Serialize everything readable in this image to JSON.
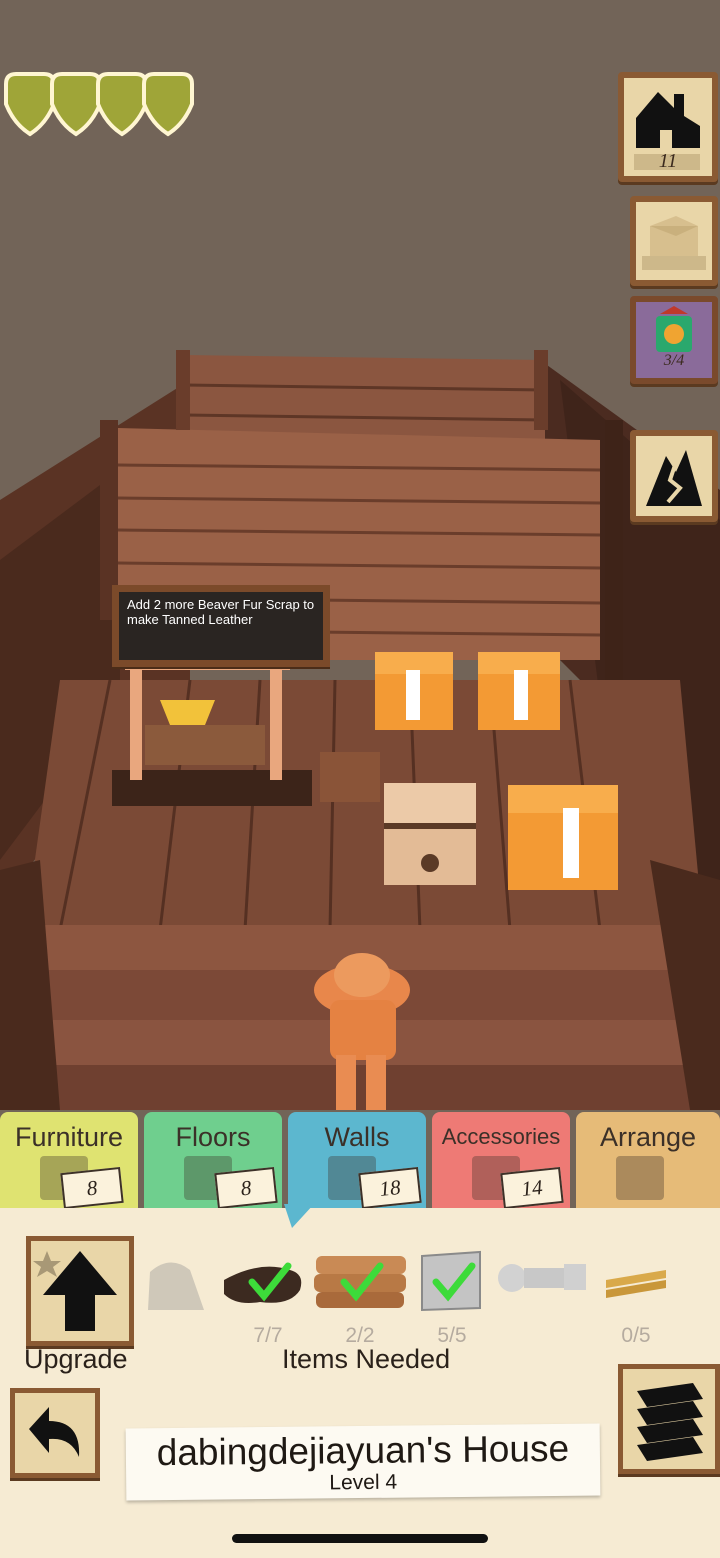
{
  "hud": {
    "hearts": 4,
    "heart_color": "#9fa538",
    "buttons": [
      {
        "name": "house-icon",
        "count": "11"
      },
      {
        "name": "box-icon",
        "count": ""
      },
      {
        "name": "totem-icon",
        "count": "3/4"
      },
      {
        "name": "map-icon",
        "count": ""
      }
    ]
  },
  "sign": {
    "text": "Add 2 more Beaver Fur Scrap to make Tanned Leather"
  },
  "tabs": [
    {
      "label": "Furniture",
      "count": "8",
      "color": "#dfe371",
      "icon": "chair-icon"
    },
    {
      "label": "Floors",
      "count": "8",
      "color": "#6fcf8e",
      "icon": "floor-icon"
    },
    {
      "label": "Walls",
      "count": "18",
      "color": "#5cb7cf",
      "icon": "picture-frame-icon"
    },
    {
      "label": "Accessories",
      "count": "14",
      "color": "#ee7a75",
      "icon": "flower-pot-icon"
    },
    {
      "label": "Arrange",
      "count": "",
      "color": "#e6bb78",
      "icon": "crate-icon"
    }
  ],
  "panel": {
    "upgrade_label": "Upgrade",
    "items_needed_label": "Items Needed",
    "items": [
      {
        "name": "stone-item",
        "count": "",
        "done": false
      },
      {
        "name": "leather-item",
        "count": "7/7",
        "done": true
      },
      {
        "name": "planks-item",
        "count": "2/2",
        "done": true
      },
      {
        "name": "metal-sheet-item",
        "count": "5/5",
        "done": true
      },
      {
        "name": "screw-item",
        "count": "",
        "done": false
      },
      {
        "name": "wood-sticks-item",
        "count": "0/5",
        "done": false
      }
    ],
    "house_name": "dabingdejiayuan's House",
    "house_level": "Level 4"
  }
}
